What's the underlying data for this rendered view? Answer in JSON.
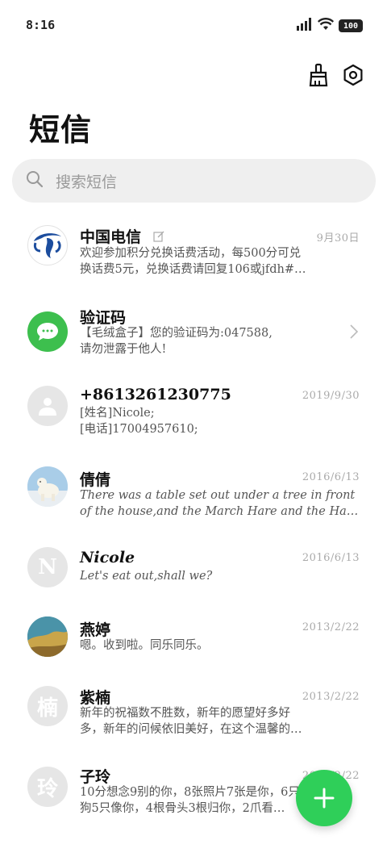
{
  "status_bar": {
    "time": "8:16",
    "battery": "100",
    "icons": [
      "signal-icon",
      "wifi-icon",
      "battery-icon"
    ]
  },
  "toolbar": {
    "icons": [
      "broom-icon",
      "settings-icon"
    ]
  },
  "page": {
    "title": "短信"
  },
  "search": {
    "placeholder": "搜索短信",
    "icon": "search-icon"
  },
  "messages": [
    {
      "sender": "中国电信",
      "date": "9月30日",
      "preview_lines": [
        "欢迎参加积分兑换话费活动，每500分可兑",
        "换话费5元，兑换话费请回复106或jfdh#…"
      ],
      "avatar": "china-telecom-logo",
      "badge_icon": "edit-icon"
    },
    {
      "sender": "验证码",
      "date": "",
      "preview_lines": [
        "【毛绒盒子】您的验证码为:047588,",
        "请勿泄露于他人!"
      ],
      "avatar": "message-bubble-icon",
      "accent": "#3dbf4e"
    },
    {
      "sender": "+8613261230775",
      "date": "2019/9/30",
      "preview_lines": [
        "[姓名]Nicole;",
        "[电话]17004957610;"
      ],
      "avatar": "person-icon"
    },
    {
      "sender": "倩倩",
      "date": "2016/6/13",
      "preview_lines": [
        "There was a table set out under a tree in front",
        "of the house,and the March Hare and the Hat…"
      ],
      "avatar": "polar-bear-photo"
    },
    {
      "sender": "Nicole",
      "date": "2016/6/13",
      "preview_lines": [
        "Let's eat out,shall we?"
      ],
      "avatar": "N"
    },
    {
      "sender": "燕婷",
      "date": "2013/2/22",
      "preview_lines": [
        "嗯。收到啦。同乐同乐。"
      ],
      "avatar": "landscape-photo"
    },
    {
      "sender": "紫楠",
      "date": "2013/2/22",
      "preview_lines": [
        "新年的祝福数不胜数，新年的愿望好多好",
        "多，新年的问候依旧美好，在这个温馨的…"
      ],
      "avatar": "楠"
    },
    {
      "sender": "子玲",
      "date": "2013/2/22",
      "preview_lines": [
        "10分想念9别的你，8张照片7张是你，6只",
        "狗5只像你，4根骨头3根归你，2爪看…"
      ],
      "avatar": "玲"
    }
  ],
  "fab": {
    "icon": "plus-icon",
    "color": "#2fcf59"
  },
  "colors": {
    "accent_green": "#2fcf59",
    "telecom_blue": "#1c4d9e"
  }
}
